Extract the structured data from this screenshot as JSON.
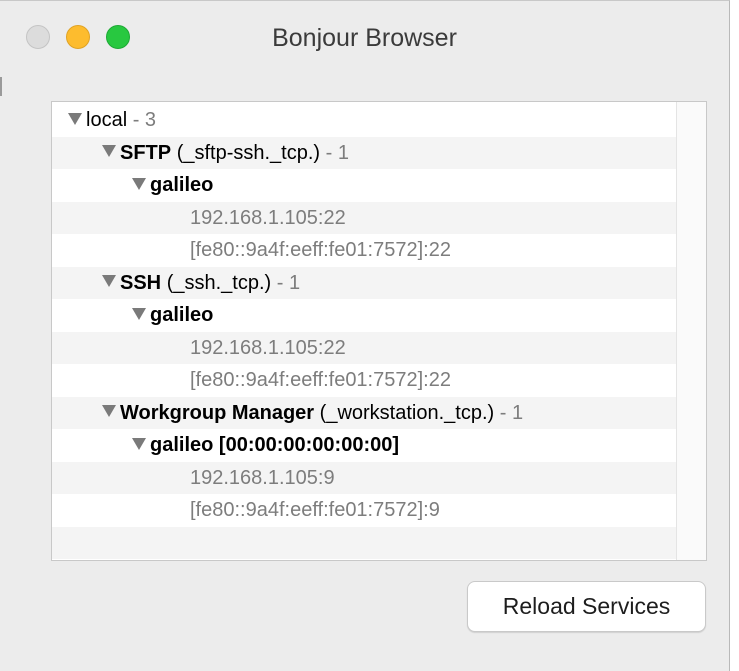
{
  "window": {
    "title": "Bonjour Browser",
    "traffic_lights": {
      "close_color": "#dcdcdc",
      "minimize_color": "#fdbc2e",
      "zoom_color": "#28c840"
    }
  },
  "tree": {
    "domain": {
      "name": "local",
      "count": "- 3"
    },
    "services": [
      {
        "name": "SFTP",
        "type": "(_sftp-ssh._tcp.)",
        "count": "- 1",
        "hosts": [
          {
            "name": "galileo",
            "addresses": [
              "192.168.1.105:22",
              "[fe80::9a4f:eeff:fe01:7572]:22"
            ]
          }
        ]
      },
      {
        "name": "SSH",
        "type": "(_ssh._tcp.)",
        "count": "- 1",
        "hosts": [
          {
            "name": "galileo",
            "addresses": [
              "192.168.1.105:22",
              "[fe80::9a4f:eeff:fe01:7572]:22"
            ]
          }
        ]
      },
      {
        "name": "Workgroup Manager",
        "type": "(_workstation._tcp.)",
        "count": "- 1",
        "hosts": [
          {
            "name": "galileo [00:00:00:00:00:00]",
            "addresses": [
              "192.168.1.105:9",
              "[fe80::9a4f:eeff:fe01:7572]:9"
            ]
          }
        ]
      }
    ]
  },
  "actions": {
    "reload_label": "Reload Services"
  },
  "icons": {
    "disclosure": "disclosure-triangle-expanded-icon"
  }
}
